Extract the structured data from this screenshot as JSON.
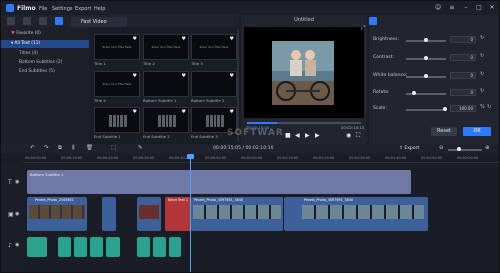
{
  "app": {
    "name": "Filmo",
    "menu": [
      "File",
      "Settings",
      "Export",
      "Help"
    ]
  },
  "toolbar": {
    "active_tab": "Fast Video"
  },
  "sidebar": {
    "items": [
      {
        "label": "Favorite (0)",
        "active": false,
        "kind": "fav"
      },
      {
        "label": "All Text (11)",
        "active": true,
        "kind": "parent"
      },
      {
        "label": "Titles (4)",
        "active": false,
        "kind": "child"
      },
      {
        "label": "Bottom Subtitles (2)",
        "active": false,
        "kind": "child"
      },
      {
        "label": "End Subtitles (5)",
        "active": false,
        "kind": "child"
      }
    ]
  },
  "templates": [
    {
      "label": "Title 1",
      "mini": "Enter Your Title Here"
    },
    {
      "label": "Title 2",
      "mini": "Enter Your Title Here"
    },
    {
      "label": "Title 3",
      "mini": "Enter Your Title Here"
    },
    {
      "label": "Title 4",
      "mini": "Enter Your Title Here"
    },
    {
      "label": "Bottom Subtitle 1",
      "mini": ""
    },
    {
      "label": "Bottom Subtitle 2",
      "mini": ""
    },
    {
      "label": "End Subtitle 1",
      "mini": ""
    },
    {
      "label": "End Subtitle 2",
      "mini": ""
    },
    {
      "label": "End Subtitle 3",
      "mini": ""
    }
  ],
  "preview": {
    "title": "Untitled",
    "current_time": "00:00:15:05",
    "total_time": "00:02:10:10",
    "watermark": "SOFTWAR"
  },
  "properties": {
    "brightness": {
      "label": "Brightness:",
      "value": "0",
      "level": 0.5
    },
    "contrast": {
      "label": "Contrast:",
      "value": "0",
      "level": 0.5
    },
    "white_balance": {
      "label": "White balance:",
      "value": "0",
      "level": 0.5
    },
    "rotate": {
      "label": "Rotate:",
      "value": "0",
      "level": 0.2
    },
    "scale": {
      "label": "Scale:",
      "value": "100.00",
      "level": 0.95
    },
    "reset_label": "Reset",
    "ok_label": "OK"
  },
  "timeline": {
    "timecode": "00:00:15:05 / 00:02:10:10",
    "export_label": "Export",
    "ruler": [
      "00:00:00:00",
      "00:00:10:00",
      "00:00:20:00",
      "00:00:30:00",
      "00:00:40:00",
      "00:00:50:00",
      "00:01:00:00",
      "00:01:10:00",
      "00:01:20:00",
      "00:01:30:00",
      "00:01:40:00",
      "00:01:50:00",
      "00:02:00:00"
    ],
    "text_clip": "Bottom Subtitle 1",
    "title_clip": "Neon Text 1",
    "video_clips": [
      "Pexels_Photo_2545651",
      "Pexels_Photo_4597691_3840",
      "Pexels_Photo_4597691_3840"
    ]
  },
  "colors": {
    "accent": "#2f7bff",
    "text_clip": "#6e79a6",
    "video_clip": "#3d5f9a",
    "audio_clip": "#2aa38e",
    "title_clip": "#b3373a"
  }
}
